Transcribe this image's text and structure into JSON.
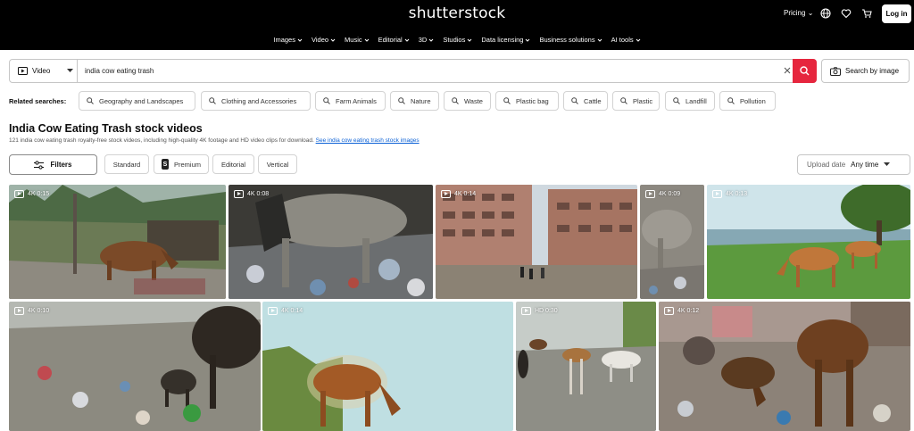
{
  "header": {
    "logo": "shutterstock",
    "pricing": "Pricing",
    "login": "Log in",
    "nav": [
      "Images",
      "Video",
      "Music",
      "Editorial",
      "3D",
      "Studios",
      "Data licensing",
      "Business solutions",
      "AI tools"
    ]
  },
  "search": {
    "type": "Video",
    "query": "india cow eating trash",
    "image_search": "Search by image"
  },
  "related": {
    "label": "Related searches:",
    "items": [
      "Geography and Landscapes",
      "Clothing and Accessories",
      "Farm Animals",
      "Nature",
      "Waste",
      "Plastic bag",
      "Cattle",
      "Plastic",
      "Landfill",
      "Pollution"
    ]
  },
  "results": {
    "title": "India Cow Eating Trash stock videos",
    "subtitle": "121 india cow eating trash royalty-free stock videos, including high-quality 4K footage and HD video clips for download.",
    "link": "See india cow eating trash stock images"
  },
  "filters": {
    "filters_label": "Filters",
    "pills": [
      "Standard",
      "Premium",
      "Editorial",
      "Vertical"
    ],
    "sort_label": "Upload date",
    "sort_value": "Any time"
  },
  "videos": [
    {
      "badge": "4K 0:15"
    },
    {
      "badge": "4K 0:08"
    },
    {
      "badge": "4K 0:14"
    },
    {
      "badge": "4K 0:09"
    },
    {
      "badge": "4K 0:13"
    },
    {
      "badge": "4K 0:10"
    },
    {
      "badge": "4K 0:14"
    },
    {
      "badge": "HD 0:30"
    },
    {
      "badge": "4K 0:12"
    }
  ],
  "colors": {
    "header_bg": "#000000",
    "search_button": "#e6263e",
    "link": "#0b61d6"
  }
}
